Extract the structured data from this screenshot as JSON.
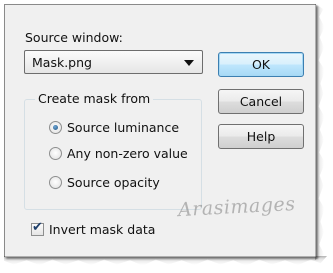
{
  "dialog": {
    "source_label": "Source window:",
    "source_select": {
      "value": "Mask.png"
    },
    "buttons": {
      "ok": "OK",
      "cancel": "Cancel",
      "help": "Help"
    },
    "group": {
      "title": "Create mask from",
      "options": [
        {
          "label": "Source luminance",
          "checked": true
        },
        {
          "label": "Any non-zero value",
          "checked": false
        },
        {
          "label": "Source opacity",
          "checked": false
        }
      ]
    },
    "invert": {
      "label": "Invert mask data",
      "checked": true,
      "tick": "✔"
    }
  },
  "watermark": "Arasimages",
  "icons": {
    "dropdown": "chevron-down-icon",
    "check": "checkmark-icon"
  }
}
